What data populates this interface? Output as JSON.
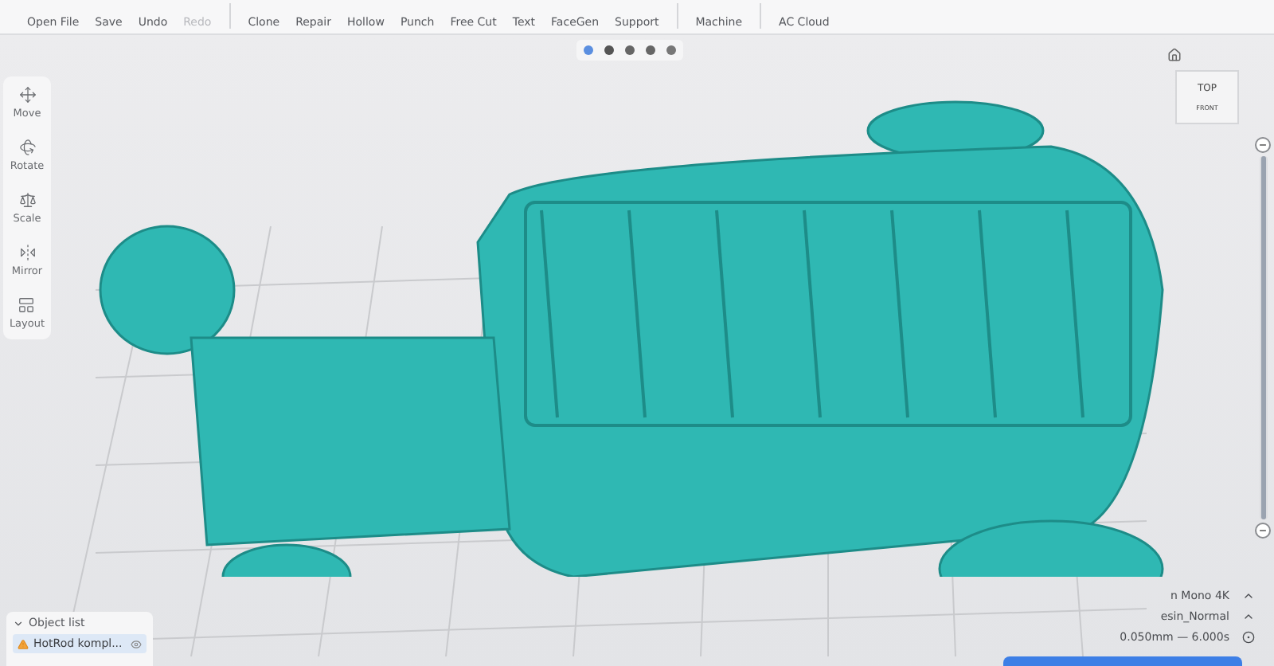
{
  "toolbar": {
    "groups": [
      [
        {
          "label": "Open File",
          "disabled": false
        },
        {
          "label": "Save",
          "disabled": false
        },
        {
          "label": "Undo",
          "disabled": false
        },
        {
          "label": "Redo",
          "disabled": true
        }
      ],
      [
        {
          "label": "Clone",
          "disabled": false
        },
        {
          "label": "Repair",
          "disabled": false
        },
        {
          "label": "Hollow",
          "disabled": false
        },
        {
          "label": "Punch",
          "disabled": false
        },
        {
          "label": "Free Cut",
          "disabled": false
        },
        {
          "label": "Text",
          "disabled": false
        },
        {
          "label": "FaceGen",
          "disabled": false
        },
        {
          "label": "Support",
          "disabled": false
        }
      ],
      [
        {
          "label": "Machine",
          "disabled": false
        }
      ],
      [
        {
          "label": "AC Cloud",
          "disabled": false
        }
      ]
    ]
  },
  "sidebar": {
    "items": [
      {
        "label": "Move"
      },
      {
        "label": "Rotate"
      },
      {
        "label": "Scale"
      },
      {
        "label": "Mirror"
      },
      {
        "label": "Layout"
      }
    ]
  },
  "nav_cube": {
    "face": "TOP",
    "side": "FRONT"
  },
  "layer_slider": {
    "level": 1
  },
  "object_list": {
    "title": "Object list",
    "expanded": true,
    "items": [
      {
        "name": "HotRod kompl...",
        "warning": true,
        "selected": true
      }
    ]
  },
  "settings": {
    "rows": [
      {
        "value": "n Mono 4K",
        "kind": "dropdown"
      },
      {
        "value": "esin_Normal",
        "kind": "dropdown"
      },
      {
        "value": "0.050mm — 6.000s",
        "kind": "target"
      }
    ]
  }
}
